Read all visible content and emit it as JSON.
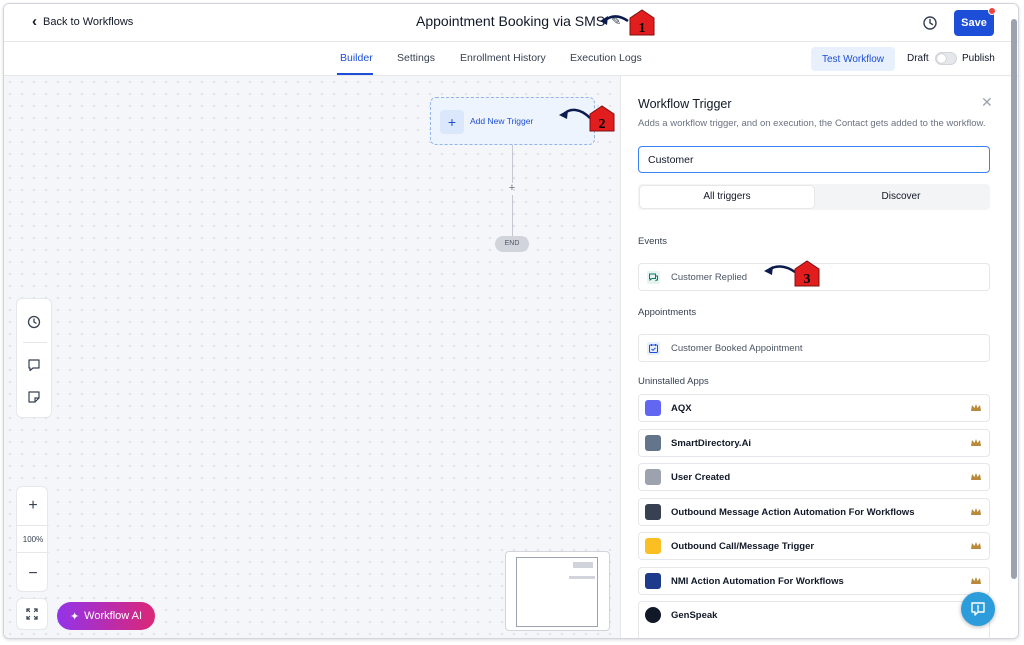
{
  "header": {
    "back_label": "Back to Workflows",
    "workflow_title": "Appointment Booking via SMS",
    "save_label": "Save"
  },
  "tabs": [
    {
      "label": "Builder",
      "active": true
    },
    {
      "label": "Settings"
    },
    {
      "label": "Enrollment History"
    },
    {
      "label": "Execution Logs"
    }
  ],
  "actions": {
    "test_label": "Test Workflow",
    "draft_label": "Draft",
    "publish_label": "Publish",
    "publish_enabled": false
  },
  "canvas": {
    "add_trigger_label": "Add New Trigger",
    "end_label": "END",
    "zoom_level": "100%",
    "ai_button_label": "Workflow AI"
  },
  "panel": {
    "title": "Workflow Trigger",
    "description": "Adds a workflow trigger, and on execution, the Contact gets added to the workflow.",
    "search_value": "Customer",
    "seg_all": "All triggers",
    "seg_discover": "Discover",
    "sections": {
      "events": "Events",
      "appointments": "Appointments",
      "uninstalled": "Uninstalled Apps"
    },
    "events": [
      {
        "label": "Customer Replied",
        "icon": "chat-icon"
      }
    ],
    "appointments": [
      {
        "label": "Customer Booked Appointment",
        "icon": "calendar-check-icon"
      }
    ],
    "apps": [
      {
        "label": "AQX",
        "color": "#6366f1"
      },
      {
        "label": "SmartDirectory.Ai",
        "color": "#64748b"
      },
      {
        "label": "User Created",
        "color": "#9ca3af"
      },
      {
        "label": "Outbound Message Action Automation For Workflows",
        "color": "#374151"
      },
      {
        "label": "Outbound Call/Message Trigger",
        "color": "#fbbf24"
      },
      {
        "label": "NMI Action Automation For Workflows",
        "color": "#1e3a8a"
      },
      {
        "label": "GenSpeak",
        "color": "#111827"
      }
    ]
  },
  "annotations": [
    "1",
    "2",
    "3"
  ],
  "colors": {
    "accent": "#1d4ed8",
    "annotation": "#e11d1d",
    "crown": "#b98a3b"
  }
}
